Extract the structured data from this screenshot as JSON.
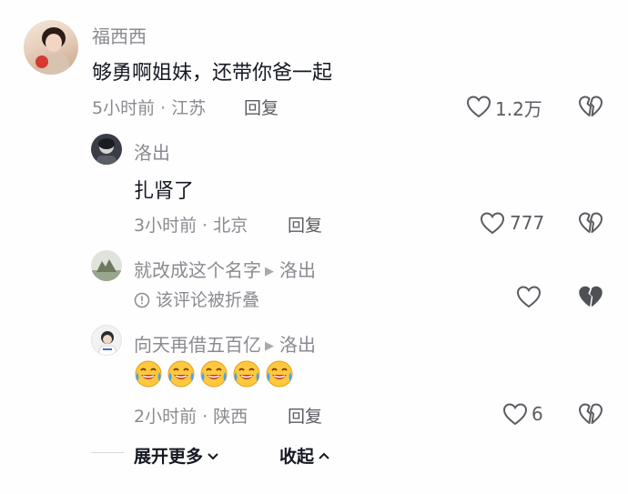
{
  "comments": [
    {
      "username": "福西西",
      "text": "够勇啊姐妹，还带你爸一起",
      "meta": "5小时前 · 江苏",
      "reply_label": "回复",
      "like_count": "1.2万"
    },
    {
      "username": "洛出",
      "text": "扎肾了",
      "meta": "3小时前 · 北京",
      "reply_label": "回复",
      "like_count": "777"
    },
    {
      "username": "就改成这个名字",
      "reply_to": "洛出",
      "text": "该评论被折叠",
      "like_count": ""
    },
    {
      "username": "向天再借五百亿",
      "reply_to": "洛出",
      "emoji_name": "laughing-crying-emoji",
      "emoji_count": 5,
      "meta": "2小时前 · 陕西",
      "reply_label": "回复",
      "like_count": "6"
    }
  ],
  "footer": {
    "expand_label": "展开更多",
    "collapse_label": "收起"
  },
  "colors": {
    "secondary_text": "#8a8b91",
    "primary_text": "#161823",
    "icon_gray": "#5b5c62"
  }
}
